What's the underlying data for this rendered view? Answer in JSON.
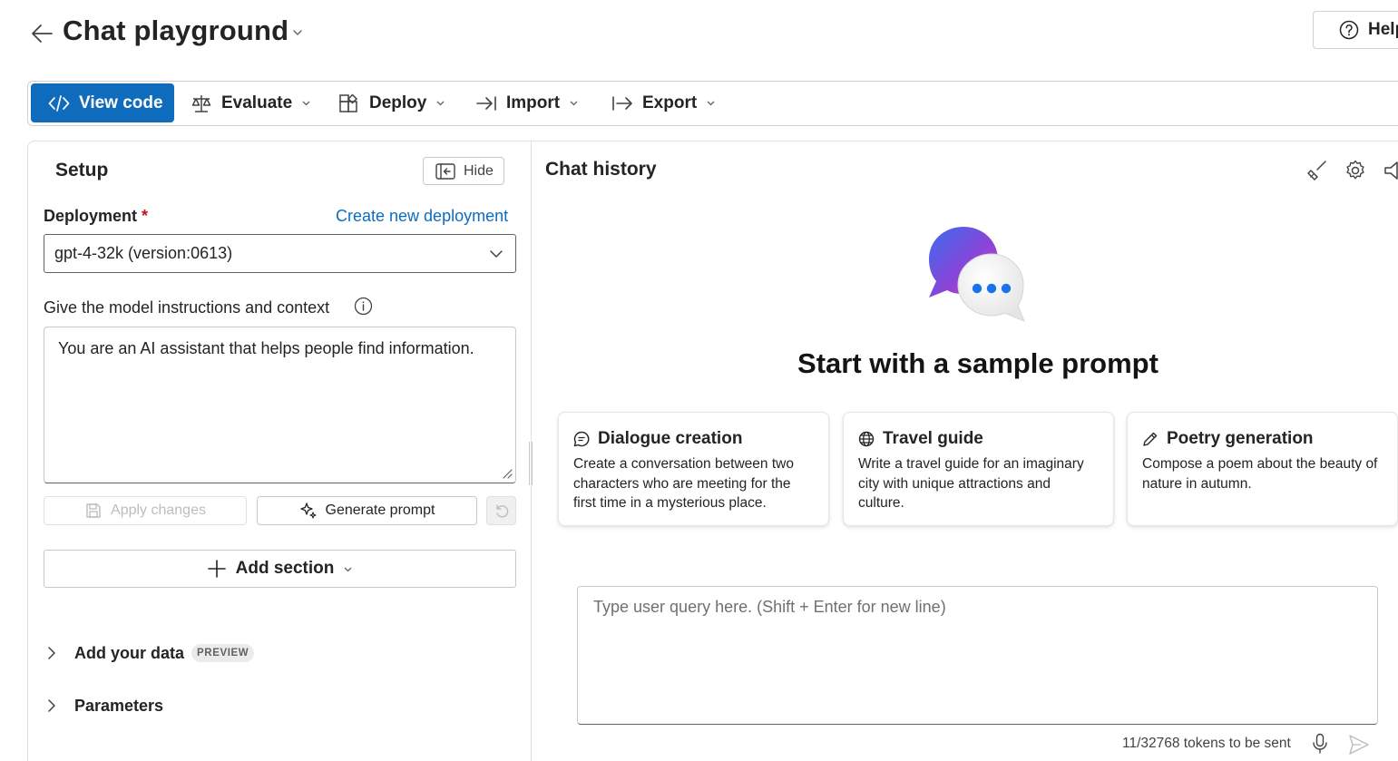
{
  "header": {
    "title": "Chat playground",
    "help_label": "Help"
  },
  "toolbar": {
    "view_code": "View code",
    "evaluate": "Evaluate",
    "deploy": "Deploy",
    "import": "Import",
    "export": "Export"
  },
  "setup": {
    "title": "Setup",
    "hide_label": "Hide",
    "deployment_label": "Deployment",
    "required_mark": "*",
    "create_link": "Create new deployment",
    "deployment_value": "gpt-4-32k (version:0613)",
    "instructions_label": "Give the model instructions and context",
    "system_message": "You are an AI assistant that helps people find information.",
    "apply_label": "Apply changes",
    "generate_label": "Generate prompt",
    "add_section_label": "Add section",
    "add_data_label": "Add your data",
    "preview_badge": "PREVIEW",
    "parameters_label": "Parameters"
  },
  "chat": {
    "title": "Chat history",
    "hero_title": "Start with a sample prompt",
    "cards": [
      {
        "icon": "chat-bubble-icon",
        "title": "Dialogue creation",
        "desc": "Create a conversation between two characters who are meeting for the first time in a mysterious place."
      },
      {
        "icon": "globe-icon",
        "title": "Travel guide",
        "desc": "Write a travel guide for an imaginary city with unique attractions and culture."
      },
      {
        "icon": "pen-icon",
        "title": "Poetry generation",
        "desc": "Compose a poem about the beauty of nature in autumn."
      }
    ],
    "query_placeholder": "Type user query here. (Shift + Enter for new line)",
    "token_count": "11/32768 tokens to be sent"
  },
  "colors": {
    "primary": "#0f6cbd",
    "required": "#c50f1f"
  }
}
